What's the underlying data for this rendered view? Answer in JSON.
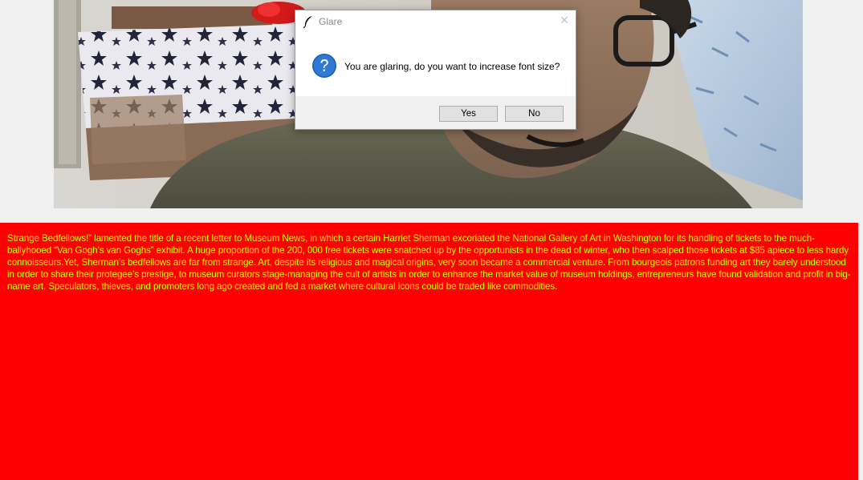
{
  "webcam": {
    "label": "webcam-feed"
  },
  "dialog": {
    "title": "Glare",
    "message": "You are glaring, do you want to increase font size?",
    "buttons": {
      "yes": "Yes",
      "no": "No"
    },
    "close_glyph": "✕",
    "icons": {
      "title": "feather-icon",
      "message": "question-icon",
      "close": "close-icon"
    }
  },
  "text_panel": {
    "background": "#ff0000",
    "text_color": "#c8ff00",
    "body": "Strange Bedfellows!” lamented the title of a recent letter to Museum News, in which a certain Harriet Sherman excoriated the National Gallery of Art in Washington for its handling of tickets to the much-ballyhooed “Van Gogh’s van Goghs” exhibit. A huge proportion of the 200, 000 free tickets were snatched up by the opportunists in the dead of winter, who then scalped those tickets at $85 apiece to less hardy connoisseurs.Yet, Sherman’s bedfellows are far from strange. Art, despite its religious and magical origins, very soon became a commercial venture. From bourgeois patrons funding art they barely understood in order to share their protegee’s prestige, to museum curators stage-managing the cult of artists in order to enhance the market value of museum holdings, entrepreneurs have found validation and profit in big-name art. Speculators, thieves, and promoters long ago created and fed a market where cultural icons could be traded like commodities."
  }
}
